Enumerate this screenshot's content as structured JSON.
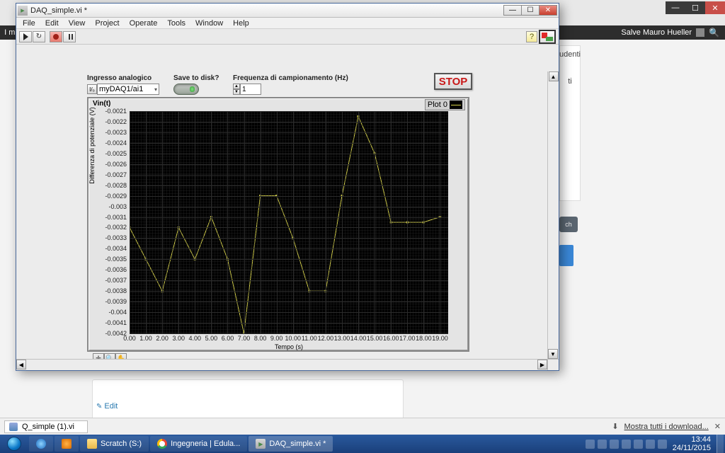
{
  "browser": {
    "window_buttons": {
      "min": "—",
      "max": "☐",
      "close": "✕"
    },
    "blackbar_user": "Salve Mauro Hueller",
    "left_tag": "I mi",
    "side_text1": "udenti",
    "side_text2": "ti",
    "side_text3": "ch"
  },
  "edit_link": "Edit",
  "downloadbar": {
    "file": "Q_simple (1).vi",
    "show_all": "Mostra tutti i download..."
  },
  "taskbar": {
    "items": [
      {
        "label": "Scratch (S:)",
        "icon": "fold"
      },
      {
        "label": "Ingegneria | Edula...",
        "icon": "chrome"
      },
      {
        "label": "DAQ_simple.vi *",
        "icon": "lv",
        "active": true
      }
    ],
    "clock_time": "13:44",
    "clock_date": "24/11/2015"
  },
  "labview": {
    "title": "DAQ_simple.vi *",
    "menus": [
      "File",
      "Edit",
      "View",
      "Project",
      "Operate",
      "Tools",
      "Window",
      "Help"
    ],
    "controls": {
      "ingresso_label": "Ingresso analogico",
      "ingresso_value": "myDAQ1/ai1",
      "save_label": "Save to disk?",
      "freq_label": "Frequenza di campionamento (Hz)",
      "freq_value": "1",
      "stop_label": "STOP"
    },
    "chart": {
      "title": "Vin(t)",
      "legend": "Plot 0",
      "xlabel": "Tempo (s)",
      "ylabel": "Differenza di potenziale (V)"
    }
  },
  "chart_data": {
    "type": "line",
    "xlabel": "Tempo (s)",
    "ylabel": "Differenza di potenziale (V)",
    "xlim": [
      0,
      19.5
    ],
    "ylim": [
      -0.0042,
      -0.0021
    ],
    "xticks": [
      "0.00",
      "1.00",
      "2.00",
      "3.00",
      "4.00",
      "5.00",
      "6.00",
      "7.00",
      "8.00",
      "9.00",
      "10.00",
      "11.00",
      "12.00",
      "13.00",
      "14.00",
      "15.00",
      "16.00",
      "17.00",
      "18.00",
      "19.00"
    ],
    "yticks": [
      "-0.0021",
      "-0.0022",
      "-0.0023",
      "-0.0024",
      "-0.0025",
      "-0.0026",
      "-0.0027",
      "-0.0028",
      "-0.0029",
      "-0.003",
      "-0.0031",
      "-0.0032",
      "-0.0033",
      "-0.0034",
      "-0.0035",
      "-0.0036",
      "-0.0037",
      "-0.0038",
      "-0.0039",
      "-0.004",
      "-0.0041",
      "-0.0042"
    ],
    "series": [
      {
        "name": "Plot 0",
        "color": "#d6d24a",
        "x": [
          0,
          1,
          2,
          3,
          4,
          5,
          6,
          7,
          8,
          9,
          10,
          11,
          12,
          13,
          14,
          15,
          16,
          17,
          18,
          19
        ],
        "y": [
          -0.0032,
          -0.0035,
          -0.0038,
          -0.0032,
          -0.0035,
          -0.0031,
          -0.0035,
          -0.0042,
          -0.0029,
          -0.0029,
          -0.0033,
          -0.0038,
          -0.0038,
          -0.0029,
          -0.00215,
          -0.0025,
          -0.00315,
          -0.00315,
          -0.00315,
          -0.0031
        ]
      }
    ]
  }
}
